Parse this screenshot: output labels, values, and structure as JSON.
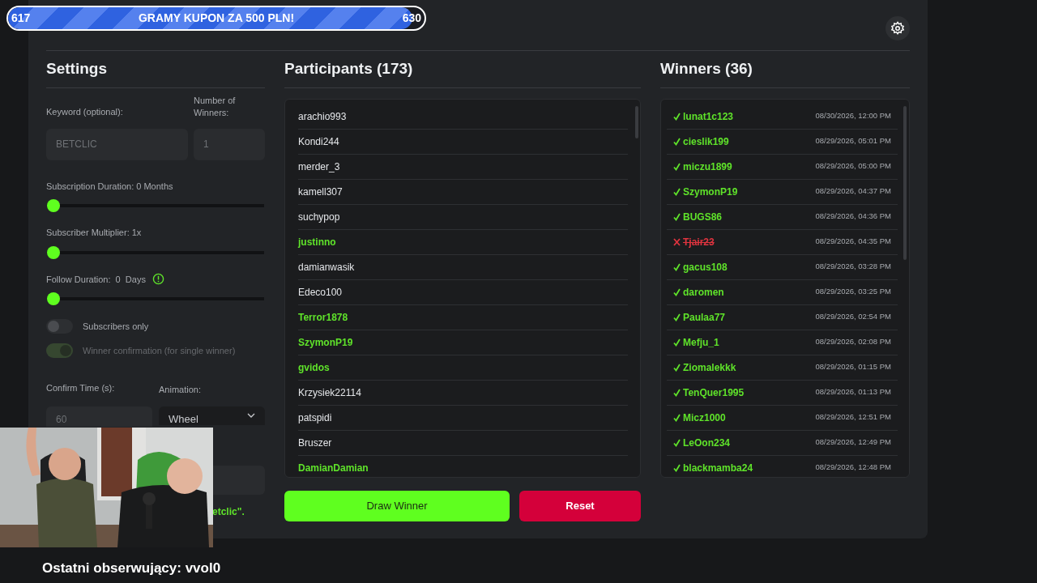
{
  "goal_bar": {
    "start": "617",
    "title": "GRAMY KUPON ZA 500 PLN!",
    "end": "630",
    "level": 0.97
  },
  "settings": {
    "title": "Settings",
    "keyword": {
      "label": "Keyword (optional):",
      "placeholder": "BETCLIC"
    },
    "winners_count": {
      "label": "Number of Winners:",
      "placeholder": "1"
    },
    "sliders": [
      {
        "label": "Subscription Duration: 0 Months",
        "level": 0,
        "info": false
      },
      {
        "label": "Subscriber Multiplier: 1x",
        "level": 0,
        "info": false
      },
      {
        "label": "Follow Duration:  0  Days",
        "level": 0,
        "info": true
      }
    ],
    "toggles": [
      {
        "label": "Subscribers only",
        "on": false,
        "disabled": false
      },
      {
        "label": "Winner confirmation (for single winner)",
        "on": true,
        "disabled": true
      }
    ],
    "confirm_time": {
      "label": "Confirm Time (s):",
      "placeholder": "60"
    },
    "animation": {
      "label": "Animation:",
      "value": "Wheel"
    },
    "note": "etclic\"."
  },
  "participants": {
    "title": "Participants (173)",
    "rows": [
      {
        "name": "arachio993",
        "highlighted": false
      },
      {
        "name": "Kondi244",
        "highlighted": false
      },
      {
        "name": "merder_3",
        "highlighted": false
      },
      {
        "name": "kamell307",
        "highlighted": false
      },
      {
        "name": "suchypop",
        "highlighted": false
      },
      {
        "name": "justinno",
        "highlighted": true
      },
      {
        "name": "damianwasik",
        "highlighted": false
      },
      {
        "name": "Edeco100",
        "highlighted": false
      },
      {
        "name": "Terror1878",
        "highlighted": true
      },
      {
        "name": "SzymonP19",
        "highlighted": true
      },
      {
        "name": "gvidos",
        "highlighted": true
      },
      {
        "name": "Krzysiek22114",
        "highlighted": false
      },
      {
        "name": "patspidi",
        "highlighted": false
      },
      {
        "name": "Bruszer",
        "highlighted": false
      },
      {
        "name": "DamianDamian",
        "highlighted": true
      }
    ]
  },
  "winners": {
    "title": "Winners (36)",
    "rows": [
      {
        "name": "lunat1c123",
        "time": "08/30/2026, 12:00 PM",
        "confirmed": true
      },
      {
        "name": "cieslik199",
        "time": "08/29/2026, 05:01 PM",
        "confirmed": true
      },
      {
        "name": "miczu1899",
        "time": "08/29/2026, 05:00 PM",
        "confirmed": true
      },
      {
        "name": "SzymonP19",
        "time": "08/29/2026, 04:37 PM",
        "confirmed": true
      },
      {
        "name": "BUGS86",
        "time": "08/29/2026, 04:36 PM",
        "confirmed": true
      },
      {
        "name": "Tjair23",
        "time": "08/29/2026, 04:35 PM",
        "confirmed": false
      },
      {
        "name": "gacus108",
        "time": "08/29/2026, 03:28 PM",
        "confirmed": true
      },
      {
        "name": "daromen",
        "time": "08/29/2026, 03:25 PM",
        "confirmed": true
      },
      {
        "name": "Paulaa77",
        "time": "08/29/2026, 02:54 PM",
        "confirmed": true
      },
      {
        "name": "Mefju_1",
        "time": "08/29/2026, 02:08 PM",
        "confirmed": true
      },
      {
        "name": "Ziomalekkk",
        "time": "08/29/2026, 01:15 PM",
        "confirmed": true
      },
      {
        "name": "TenQuer1995",
        "time": "08/29/2026, 01:13 PM",
        "confirmed": true
      },
      {
        "name": "Micz1000",
        "time": "08/29/2026, 12:51 PM",
        "confirmed": true
      },
      {
        "name": "LeOon234",
        "time": "08/29/2026, 12:49 PM",
        "confirmed": true
      },
      {
        "name": "blackmamba24",
        "time": "08/29/2026, 12:48 PM",
        "confirmed": true
      }
    ]
  },
  "buttons": {
    "draw": "Draw Winner",
    "reset": "Reset"
  },
  "last_follower": "Ostatni obserwujący: vvol0"
}
